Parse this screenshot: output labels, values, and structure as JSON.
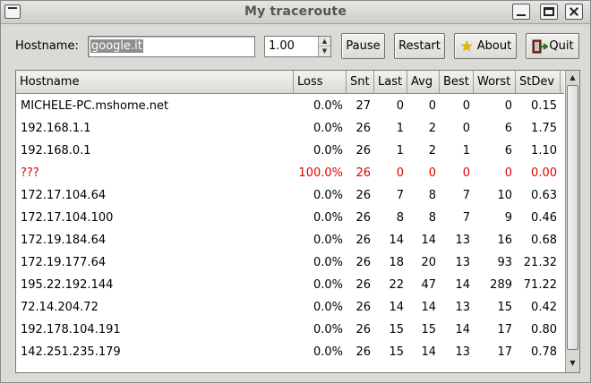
{
  "window": {
    "title": "My traceroute"
  },
  "toolbar": {
    "hostname_label": "Hostname:",
    "hostname_value": "google.it",
    "interval_value": "1.00",
    "pause_label": "Pause",
    "restart_label": "Restart",
    "about_label": "About",
    "quit_label": "Quit"
  },
  "table": {
    "columns": [
      "Hostname",
      "Loss",
      "Snt",
      "Last",
      "Avg",
      "Best",
      "Worst",
      "StDev"
    ],
    "rows": [
      [
        "MICHELE-PC.mshome.net",
        "0.0%",
        "27",
        "0",
        "0",
        "0",
        "0",
        "0.15"
      ],
      [
        "192.168.1.1",
        "0.0%",
        "26",
        "1",
        "2",
        "0",
        "6",
        "1.75"
      ],
      [
        "192.168.0.1",
        "0.0%",
        "26",
        "1",
        "2",
        "1",
        "6",
        "1.10"
      ],
      [
        "???",
        "100.0%",
        "26",
        "0",
        "0",
        "0",
        "0",
        "0.00"
      ],
      [
        "172.17.104.64",
        "0.0%",
        "26",
        "7",
        "8",
        "7",
        "10",
        "0.63"
      ],
      [
        "172.17.104.100",
        "0.0%",
        "26",
        "8",
        "8",
        "7",
        "9",
        "0.46"
      ],
      [
        "172.19.184.64",
        "0.0%",
        "26",
        "14",
        "14",
        "13",
        "16",
        "0.68"
      ],
      [
        "172.19.177.64",
        "0.0%",
        "26",
        "18",
        "20",
        "13",
        "93",
        "21.32"
      ],
      [
        "195.22.192.144",
        "0.0%",
        "26",
        "22",
        "47",
        "14",
        "289",
        "71.22"
      ],
      [
        "72.14.204.72",
        "0.0%",
        "26",
        "14",
        "14",
        "13",
        "15",
        "0.42"
      ],
      [
        "192.178.104.191",
        "0.0%",
        "26",
        "15",
        "15",
        "14",
        "17",
        "0.80"
      ],
      [
        "142.251.235.179",
        "0.0%",
        "26",
        "15",
        "14",
        "13",
        "17",
        "0.78"
      ]
    ],
    "error_row_index": 3,
    "error_color": "#e00000"
  },
  "icons": {
    "about": "star-icon",
    "quit": "exit-door-icon"
  }
}
